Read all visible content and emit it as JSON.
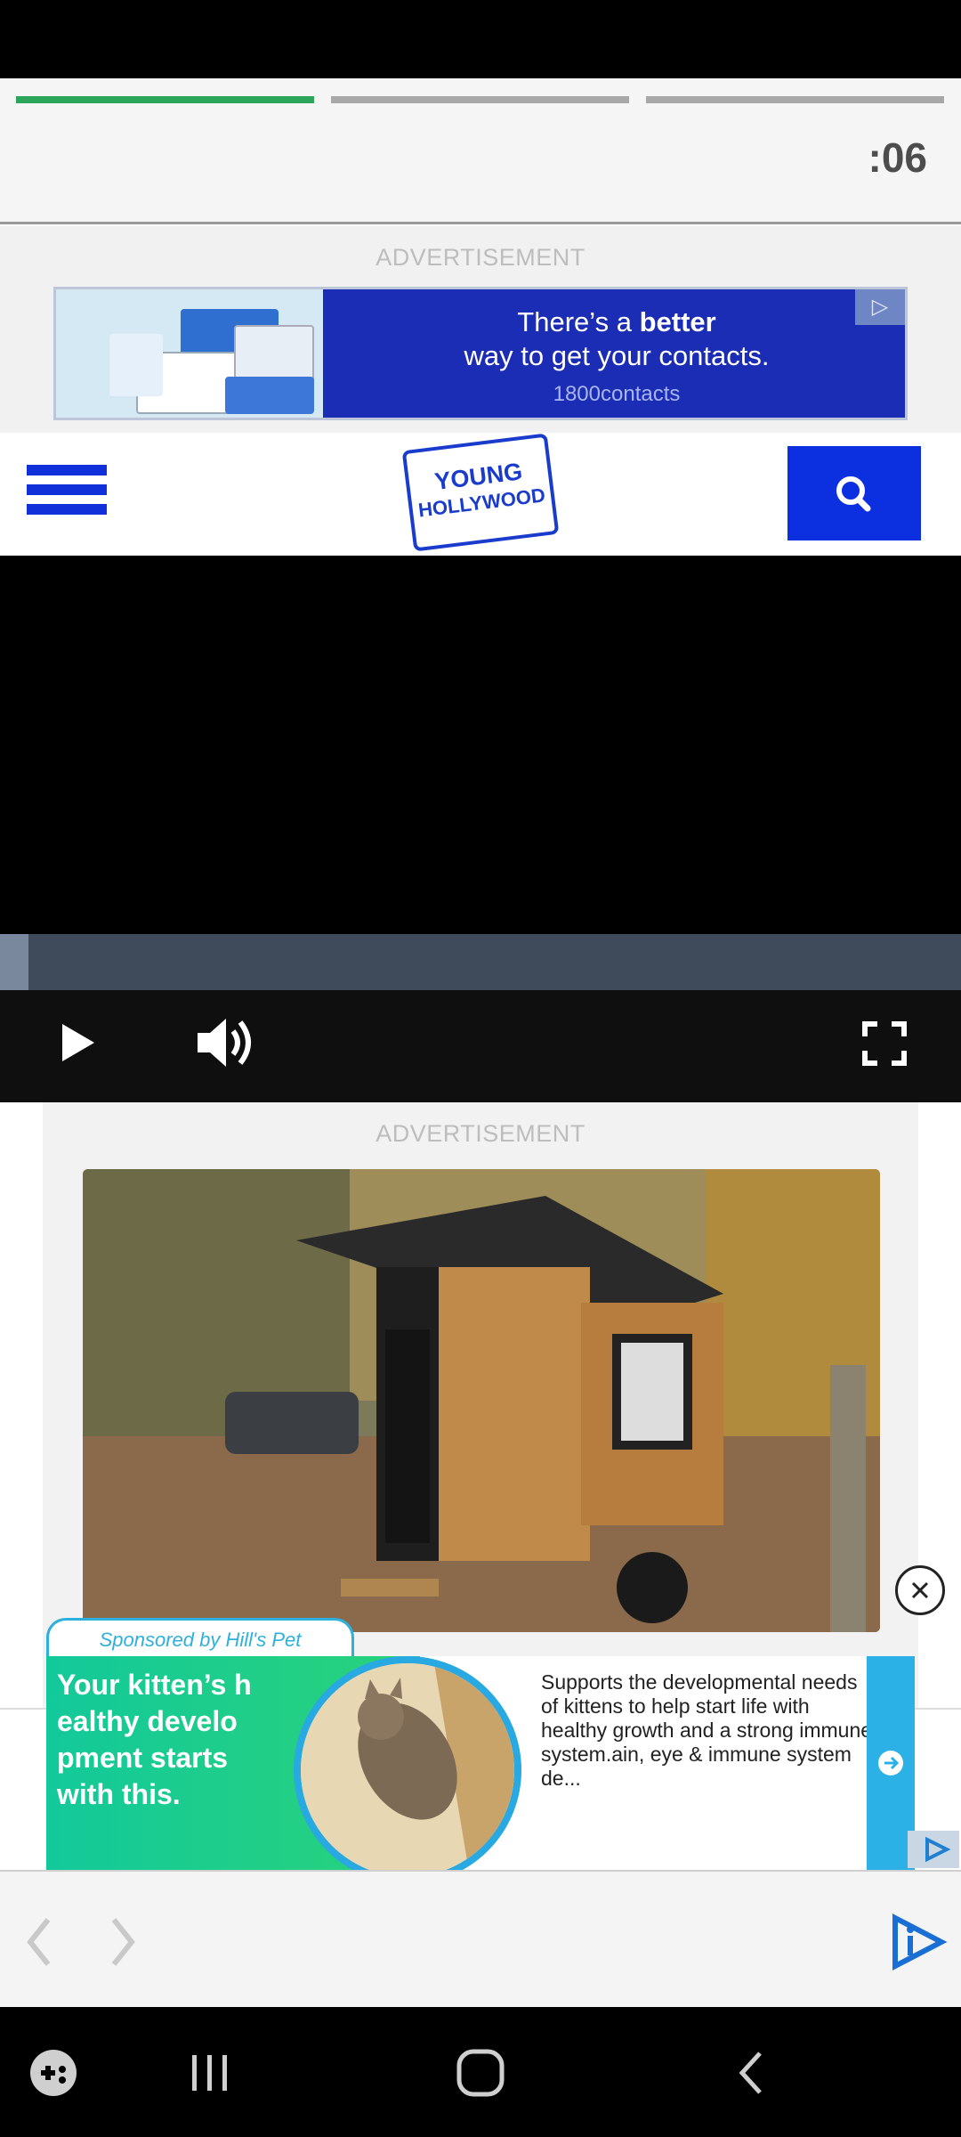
{
  "story": {
    "progress_segments": [
      {
        "state": "active"
      },
      {
        "state": "inactive"
      },
      {
        "state": "inactive"
      }
    ],
    "timer": ":06"
  },
  "ad_top": {
    "label": "ADVERTISEMENT",
    "headline_pre": "There’s a ",
    "headline_bold": "better",
    "headline_post": "way to get your contacts.",
    "brand": "1800contacts"
  },
  "site": {
    "logo_line1": "YOUNG",
    "logo_line2": "HOLLYWOOD",
    "menu_icon": "hamburger-icon",
    "search_icon": "search-icon"
  },
  "video": {
    "progress": 0.03,
    "play_icon": "play-icon",
    "volume_icon": "volume-icon",
    "fullscreen_icon": "fullscreen-icon"
  },
  "ad_mid": {
    "label": "ADVERTISEMENT",
    "image": "tiny wooden cabin on trailer in autumn forest"
  },
  "sponsored": {
    "tab": "Sponsored by Hill's Pet",
    "headline": "Your kitten’s h ealthy develo pment starts with this.",
    "body": "Supports the developmental needs of kittens to help start life with healthy growth and a strong immune system.ain, eye & immune system de...",
    "close_icon": "close-icon",
    "arrow_icon": "arrow-right-icon"
  },
  "browser": {
    "back_icon": "chevron-left-icon",
    "forward_icon": "chevron-right-icon",
    "app_icon": "play-i-icon"
  },
  "system_nav": {
    "game_icon": "game-launcher-icon",
    "recents_icon": "recents-icon",
    "home_icon": "home-icon",
    "back_icon": "back-icon"
  },
  "colors": {
    "progress_active": "#2aa55a",
    "brand_blue": "#1030d9",
    "ad_blue": "#1b2db5",
    "sponsor_cyan": "#2cb1e6",
    "sponsor_green": "#13c99a"
  }
}
